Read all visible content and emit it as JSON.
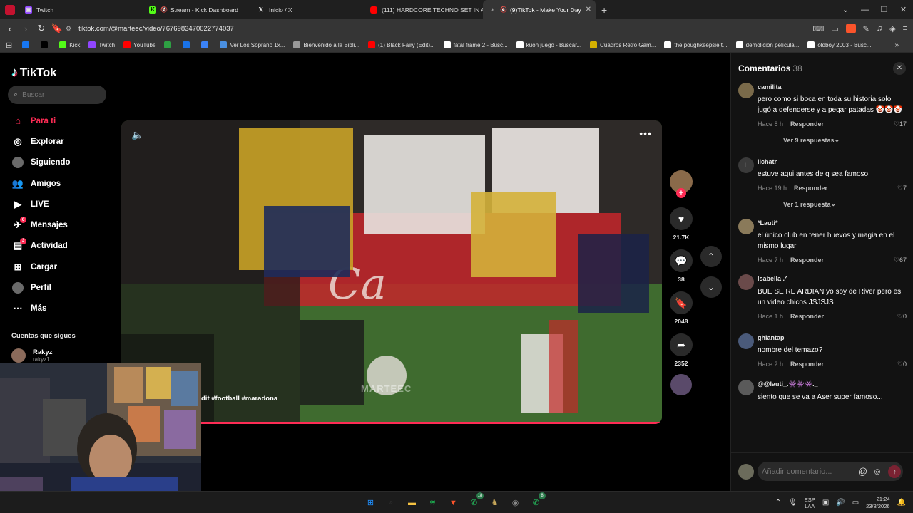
{
  "browser": {
    "tabs": [
      {
        "label": "Twitch",
        "icon": "twitch-icon",
        "color": "#9146ff",
        "active": false
      },
      {
        "label": "Stream - Kick Dashboard",
        "icon": "kick-icon",
        "color": "#53fc18",
        "active": false,
        "muted": true
      },
      {
        "label": "Inicio / X",
        "icon": "x-icon",
        "color": "#ffffff",
        "active": false
      },
      {
        "label": "(111) HARDCORE TECHNO SET IN A",
        "icon": "youtube-icon",
        "color": "#ff0000",
        "active": false
      },
      {
        "label": "(9)TikTok - Make Your Day",
        "icon": "tiktok-icon",
        "color": "#000000",
        "active": true,
        "muted": true
      }
    ],
    "url": "tiktok.com/@marteec/video/7676983470022774037",
    "bookmarks": [
      {
        "label": "",
        "icon": "facebook-icon",
        "color": "#1877f2"
      },
      {
        "label": "",
        "icon": "x-icon",
        "color": "#000000"
      },
      {
        "label": "Kick",
        "icon": "kick-icon",
        "color": "#53fc18"
      },
      {
        "label": "Twitch",
        "icon": "twitch-icon",
        "color": "#9146ff"
      },
      {
        "label": "YouTube",
        "icon": "youtube-icon",
        "color": "#ff0000"
      },
      {
        "label": "",
        "icon": "bookmark-green-icon",
        "color": "#2ea043"
      },
      {
        "label": "",
        "icon": "cloud-icon",
        "color": "#1a73e8"
      },
      {
        "label": "",
        "icon": "bookmark-blue-icon",
        "color": "#3b82f6"
      },
      {
        "label": "Ver Los Soprano 1x...",
        "icon": "page-icon",
        "color": "#4a90e2"
      },
      {
        "label": "Bienvenido a la Bibli...",
        "icon": "page-icon",
        "color": "#999999"
      },
      {
        "label": "(1) Black Fairy (Edit)...",
        "icon": "youtube-icon",
        "color": "#ff0000"
      },
      {
        "label": "fatal frame 2 - Busc...",
        "icon": "google-icon",
        "color": "#ffffff"
      },
      {
        "label": "kuon juego - Buscar...",
        "icon": "google-icon",
        "color": "#ffffff"
      },
      {
        "label": "Cuadros Retro Gam...",
        "icon": "page-icon",
        "color": "#d4b000"
      },
      {
        "label": "the poughkeepsie t...",
        "icon": "google-icon",
        "color": "#ffffff"
      },
      {
        "label": "demolicion película...",
        "icon": "google-icon",
        "color": "#ffffff"
      },
      {
        "label": "oldboy 2003 - Busc...",
        "icon": "google-icon",
        "color": "#ffffff"
      }
    ]
  },
  "tiktok": {
    "logo": "TikTok",
    "search_placeholder": "Buscar",
    "nav": [
      {
        "label": "Para ti",
        "icon": "home-icon",
        "active": true
      },
      {
        "label": "Explorar",
        "icon": "compass-icon"
      },
      {
        "label": "Siguiendo",
        "icon": "following-avatar-icon"
      },
      {
        "label": "Amigos",
        "icon": "friends-icon"
      },
      {
        "label": "LIVE",
        "icon": "live-icon"
      },
      {
        "label": "Mensajes",
        "icon": "messages-icon",
        "badge": "6"
      },
      {
        "label": "Actividad",
        "icon": "activity-icon",
        "badge": "3"
      },
      {
        "label": "Cargar",
        "icon": "upload-icon"
      },
      {
        "label": "Perfil",
        "icon": "profile-icon"
      },
      {
        "label": "Más",
        "icon": "more-icon"
      }
    ],
    "following_title": "Cuentas que sigues",
    "following": [
      {
        "name": "Rakyz",
        "username": "rakyz1"
      }
    ],
    "video": {
      "hashtags": "dit #football #maradona",
      "watermark": "MARTEEC"
    },
    "actions": {
      "likes": "21.7K",
      "comments": "38",
      "saves": "2048",
      "shares": "2352"
    },
    "comments_panel": {
      "title": "Comentarios",
      "count": "38",
      "input_placeholder": "Añadir comentario...",
      "reply_label": "Responder",
      "comments": [
        {
          "user": "camilita",
          "text": "pero como si boca en toda su historia solo jugó a defenderse y a pegar patadas 🤡🤡🤡",
          "time": "Hace 8 h",
          "likes": "17",
          "view_replies": "Ver 9 respuestas",
          "avatar_color": "#7a6a4a"
        },
        {
          "user": "lichatr",
          "text": "estuve aqui antes de q sea famoso",
          "time": "Hace 19 h",
          "likes": "7",
          "view_replies": "Ver 1 respuesta",
          "avatar_letter": "L",
          "avatar_color": "#3a3a3a"
        },
        {
          "user": "*Lauti*",
          "text": "el único club en tener huevos y magia en el mismo lugar",
          "time": "Hace 7 h",
          "likes": "67",
          "avatar_color": "#8a7a5a"
        },
        {
          "user": "Isabella .ᐟ",
          "text": "BUE SE RE ARDIAN yo soy de River pero es un video chicos JSJSJS",
          "time": "Hace 1 h",
          "likes": "0",
          "avatar_color": "#6a4a4a"
        },
        {
          "user": "ghlantap",
          "text": "nombre del temazo?",
          "time": "Hace 2 h",
          "likes": "0",
          "avatar_color": "#4a5a7a"
        },
        {
          "user": "@@lauti_.👾👾👾._",
          "text": "siento que se va a Aser super famoso...",
          "time": "",
          "likes": "",
          "avatar_color": "#5a5a5a"
        }
      ]
    }
  },
  "taskbar": {
    "apps": [
      {
        "icon": "windows-icon",
        "color": "#1e90ff"
      },
      {
        "icon": "search-icon",
        "color": "#333333"
      },
      {
        "icon": "file-explorer-icon",
        "color": "#f5c242"
      },
      {
        "icon": "spotify-icon",
        "color": "#1db954"
      },
      {
        "icon": "brave-icon",
        "color": "#fb542b"
      },
      {
        "icon": "whatsapp-icon",
        "color": "#25d366",
        "badge": "18"
      },
      {
        "icon": "game-icon",
        "color": "#c8a85a"
      },
      {
        "icon": "chrome-icon",
        "color": "#888888"
      },
      {
        "icon": "whatsapp-business-icon",
        "color": "#25d366",
        "badge": "8"
      }
    ],
    "lang_top": "ESP",
    "lang_bottom": "LAA",
    "time": "21:24",
    "date": "23/8/2026"
  }
}
